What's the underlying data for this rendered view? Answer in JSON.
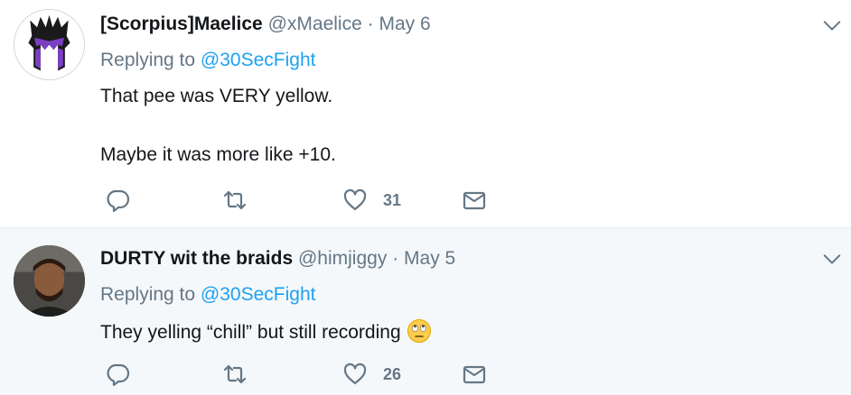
{
  "tweets": [
    {
      "fullname": "[Scorpius]Maelice",
      "username": "@xMaelice",
      "dot": "·",
      "time": "May 6",
      "replying_to_label": "Replying to",
      "replying_to_handle": "@30SecFight",
      "text_lines": [
        "That pee was VERY yellow.",
        "Maybe it was more like +10."
      ],
      "like_count": "31",
      "avatar_icon": "purple-helmet-avatar"
    },
    {
      "fullname": "DURTY wit the braids",
      "username": "@himjiggy",
      "dot": "·",
      "time": "May 5",
      "replying_to_label": "Replying to",
      "replying_to_handle": "@30SecFight",
      "text_lines": [
        "They yelling “chill” but still recording"
      ],
      "like_count": "26",
      "avatar_icon": "man-photo-avatar",
      "emoji": "face-with-rolling-eyes"
    }
  ],
  "icons": {
    "reply": "reply-icon",
    "retweet": "retweet-icon",
    "like": "heart-icon",
    "message": "envelope-icon",
    "menu": "chevron-down-icon"
  },
  "colors": {
    "link": "#1da1f2",
    "secondary_text": "#657786",
    "primary_text": "#14171a",
    "avatar_accent": "#7b3fc4"
  }
}
